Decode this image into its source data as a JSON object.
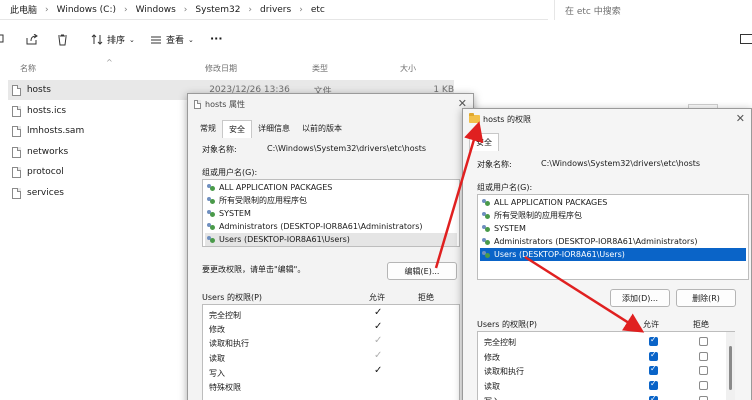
{
  "explorer": {
    "breadcrumb": [
      "此电脑",
      "Windows (C:)",
      "Windows",
      "System32",
      "drivers",
      "etc"
    ],
    "search_placeholder": "在 etc 中搜索",
    "toolbar": {
      "sort": "排序",
      "view": "查看",
      "more": "···"
    },
    "columns": {
      "name": "名称",
      "modified": "修改日期",
      "type": "类型",
      "size": "大小"
    },
    "files": [
      {
        "name": "hosts",
        "modified": "2023/12/26 13:36",
        "type": "文件",
        "size": "1 KB"
      },
      {
        "name": "hosts.ics"
      },
      {
        "name": "lmhosts.sam"
      },
      {
        "name": "networks"
      },
      {
        "name": "protocol"
      },
      {
        "name": "services"
      }
    ]
  },
  "props_dialog": {
    "title": "hosts 属性",
    "tabs": [
      "常规",
      "安全",
      "详细信息",
      "以前的版本"
    ],
    "object_label": "对象名称:",
    "object_value": "C:\\Windows\\System32\\drivers\\etc\\hosts",
    "groups_label": "组或用户名(G):",
    "groups": [
      "ALL APPLICATION PACKAGES",
      "所有受限制的应用程序包",
      "SYSTEM",
      "Administrators (DESKTOP-IOR8A61\\Administrators)",
      "Users (DESKTOP-IOR8A61\\Users)"
    ],
    "change_hint": "要更改权限，请单击\"编辑\"。",
    "edit_button": "编辑(E)...",
    "perm_label": "Users 的权限(P)",
    "allow": "允许",
    "deny": "拒绝",
    "perms": [
      "完全控制",
      "修改",
      "读取和执行",
      "读取",
      "写入",
      "特殊权限"
    ]
  },
  "perm_dialog": {
    "title": "hosts 的权限",
    "tab": "安全",
    "object_label": "对象名称:",
    "object_value": "C:\\Windows\\System32\\drivers\\etc\\hosts",
    "groups_label": "组或用户名(G):",
    "groups": [
      "ALL APPLICATION PACKAGES",
      "所有受限制的应用程序包",
      "SYSTEM",
      "Administrators (DESKTOP-IOR8A61\\Administrators)",
      "Users (DESKTOP-IOR8A61\\Users)"
    ],
    "add_button": "添加(D)...",
    "remove_button": "删除(R)",
    "perm_label": "Users 的权限(P)",
    "allow": "允许",
    "deny": "拒绝",
    "perms": [
      "完全控制",
      "修改",
      "读取和执行",
      "读取",
      "写入"
    ]
  },
  "colors": {
    "accent": "#0a64c8",
    "arrow": "#e02020"
  }
}
